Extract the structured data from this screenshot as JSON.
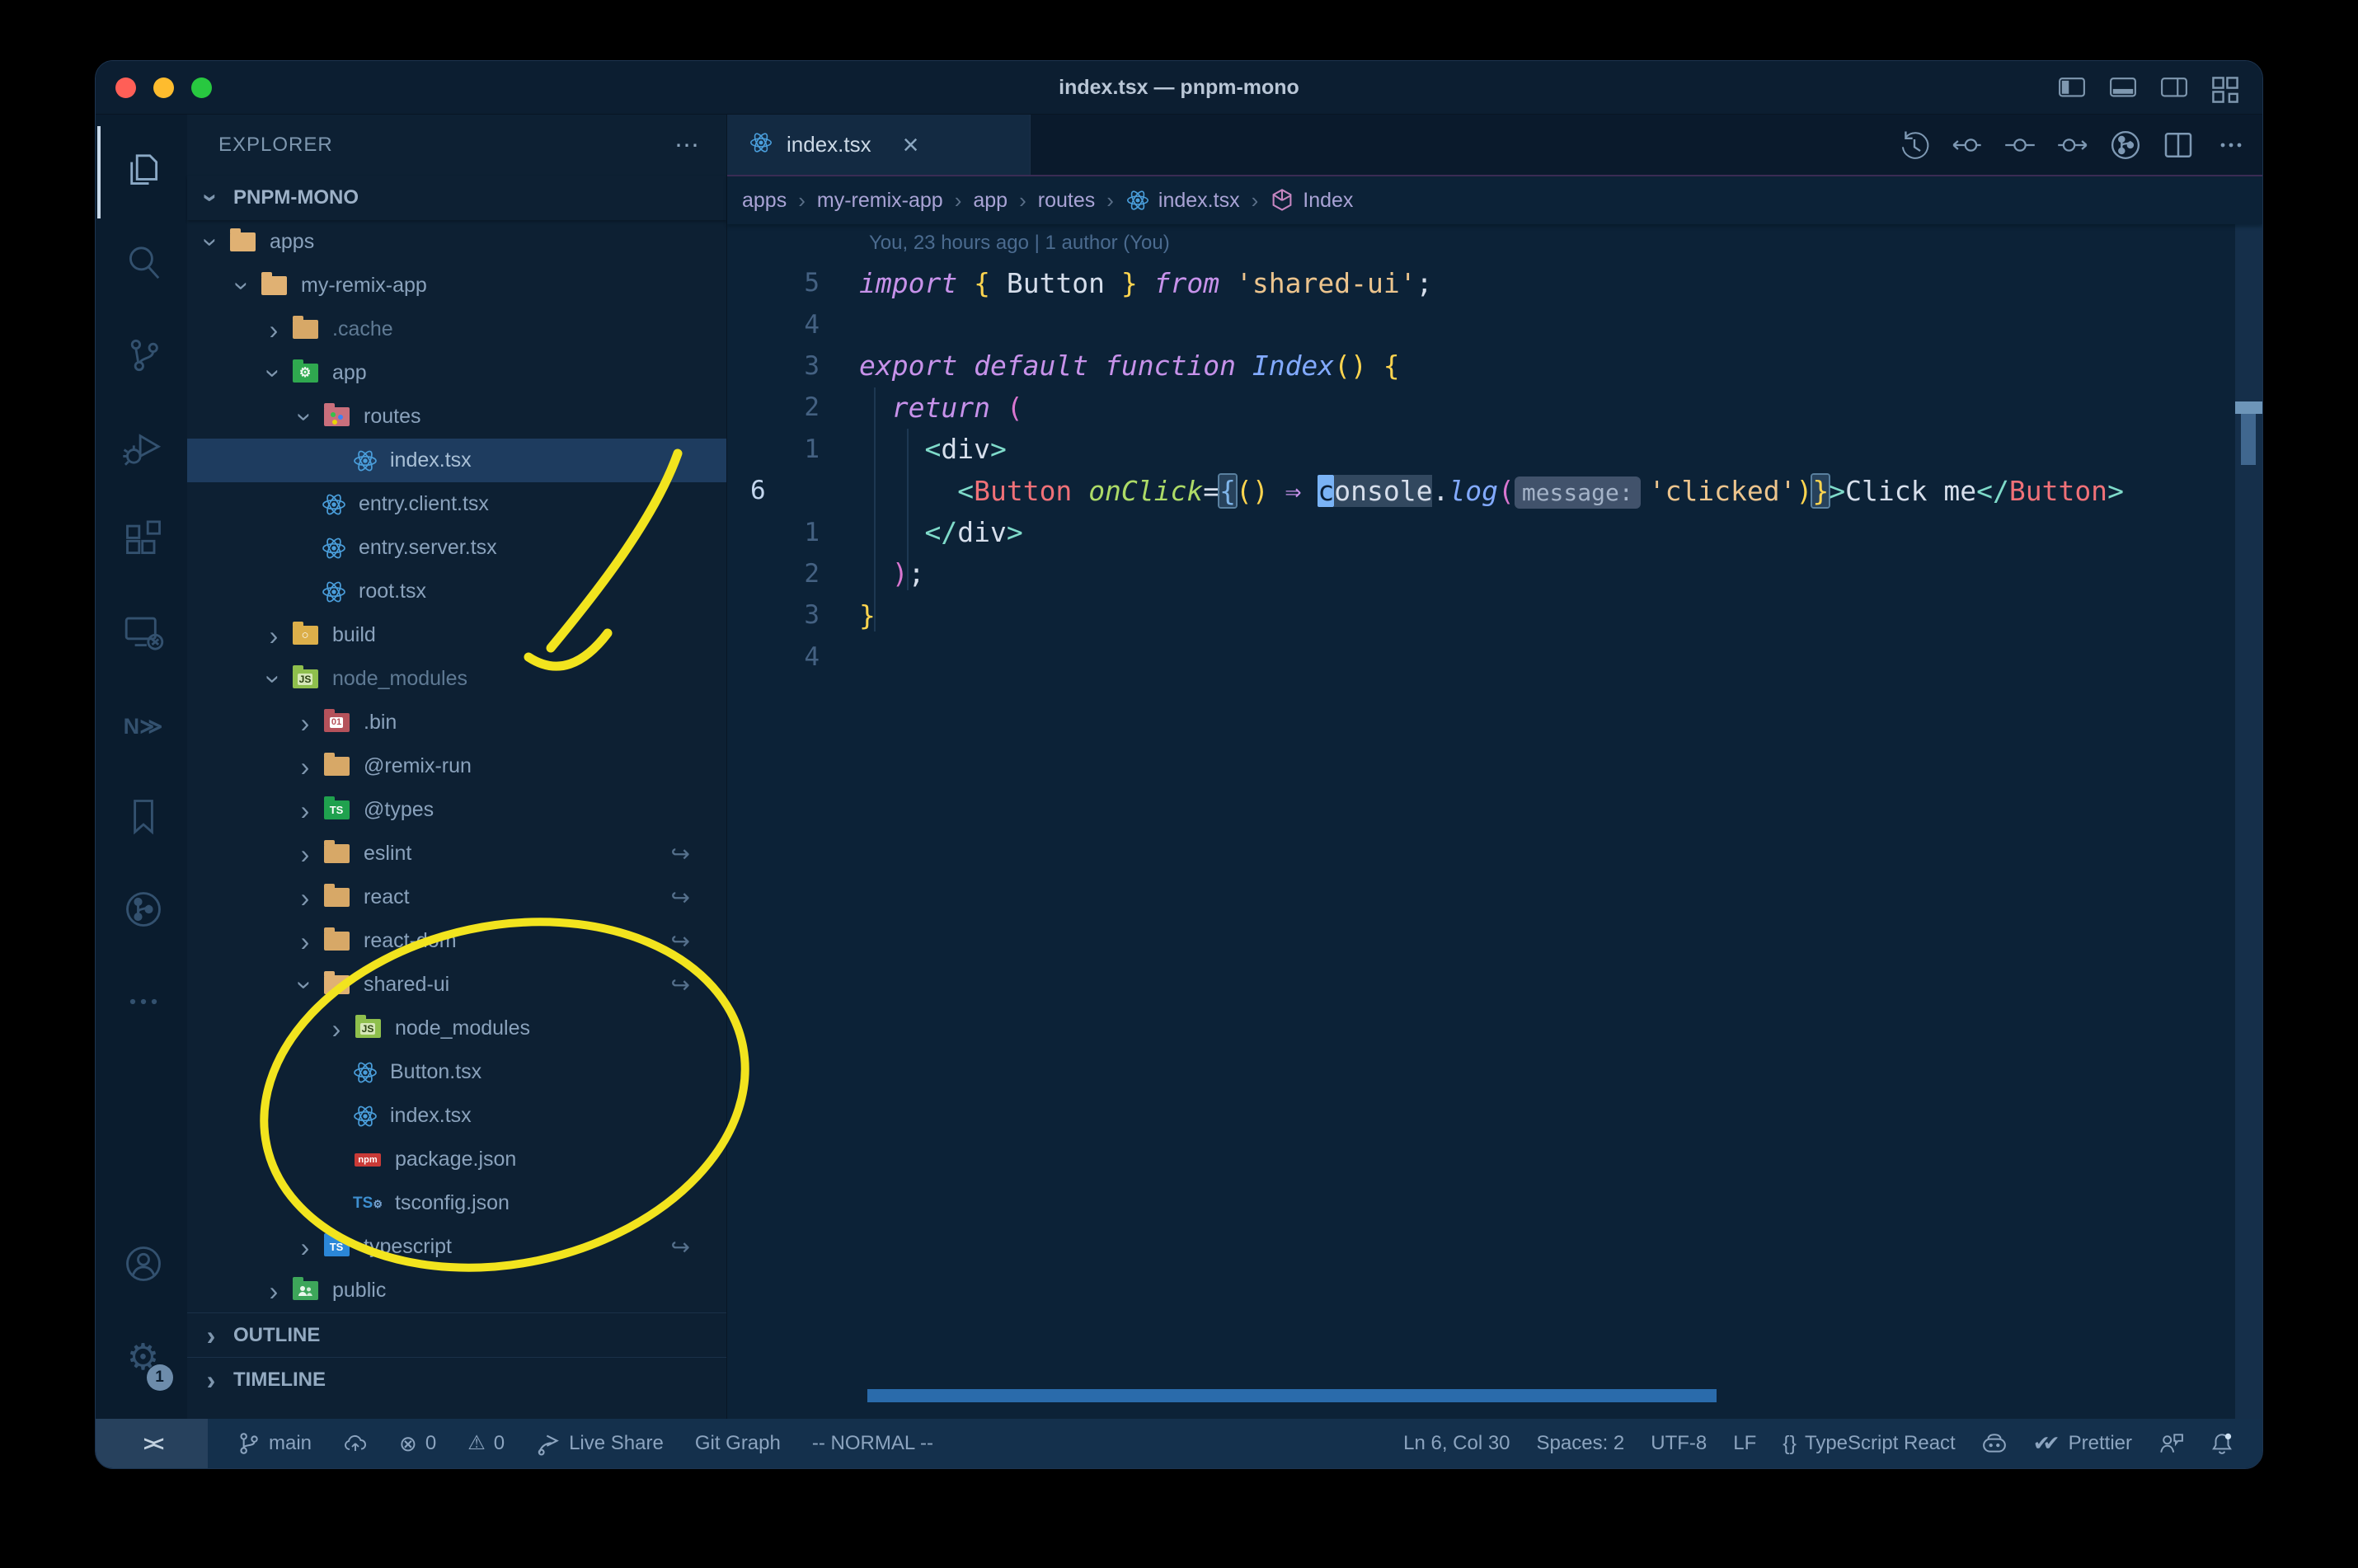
{
  "colors": {
    "annotation_yellow": "#f2e41e",
    "editor_background": "#0c2237",
    "selection_background": "#1e3c5f",
    "react_blue": "#4a9edb"
  },
  "window": {
    "title": "index.tsx — pnpm-mono"
  },
  "titlebar_icons": [
    {
      "name": "layout-sidebar-left-icon"
    },
    {
      "name": "layout-panel-icon"
    },
    {
      "name": "layout-sidebar-right-icon"
    },
    {
      "name": "layout-grid-icon"
    }
  ],
  "activity_bar": {
    "top": [
      {
        "name": "explorer",
        "icon": "files-icon",
        "active": true
      },
      {
        "name": "search",
        "icon": "search-icon"
      },
      {
        "name": "source-control",
        "icon": "source-control-icon"
      },
      {
        "name": "run-debug",
        "icon": "debug-icon"
      },
      {
        "name": "extensions",
        "icon": "extensions-icon"
      },
      {
        "name": "remote-explorer",
        "icon": "remote-explorer-icon"
      },
      {
        "name": "nx-console",
        "icon": "nx-icon"
      },
      {
        "name": "bookmarks",
        "icon": "bookmark-icon"
      },
      {
        "name": "git-graph",
        "icon": "git-graph-circle-icon"
      },
      {
        "name": "more",
        "icon": "ellipsis-icon"
      }
    ],
    "bottom": [
      {
        "name": "accounts",
        "icon": "account-icon"
      },
      {
        "name": "settings",
        "icon": "gear-icon",
        "badge": "1"
      }
    ]
  },
  "sidebar": {
    "header": "EXPLORER",
    "header_more": "⋯",
    "section": "PNPM-MONO",
    "tree": [
      {
        "label": "apps",
        "icon": "folder-open-icon",
        "depth": 1,
        "twist": "open"
      },
      {
        "label": "my-remix-app",
        "icon": "folder-open-icon",
        "depth": 2,
        "twist": "open"
      },
      {
        "label": ".cache",
        "icon": "folder-icon",
        "depth": 3,
        "twist": "closed",
        "dim": true
      },
      {
        "label": "app",
        "icon": "folder-app-icon",
        "depth": 3,
        "twist": "open"
      },
      {
        "label": "routes",
        "icon": "folder-routes-icon",
        "depth": 4,
        "twist": "open"
      },
      {
        "label": "index.tsx",
        "icon": "react-icon",
        "depth": 5,
        "file": true,
        "selected": true
      },
      {
        "label": "entry.client.tsx",
        "icon": "react-icon",
        "depth": 4,
        "file": true
      },
      {
        "label": "entry.server.tsx",
        "icon": "react-icon",
        "depth": 4,
        "file": true
      },
      {
        "label": "root.tsx",
        "icon": "react-icon",
        "depth": 4,
        "file": true
      },
      {
        "label": "build",
        "icon": "folder-dist-icon",
        "depth": 3,
        "twist": "closed"
      },
      {
        "label": "node_modules",
        "icon": "folder-node-icon",
        "depth": 3,
        "twist": "open",
        "dim": true
      },
      {
        "label": ".bin",
        "icon": "folder-bin-icon",
        "depth": 4,
        "twist": "closed"
      },
      {
        "label": "@remix-run",
        "icon": "folder-icon",
        "depth": 4,
        "twist": "closed"
      },
      {
        "label": "@types",
        "icon": "folder-types-icon",
        "depth": 4,
        "twist": "closed"
      },
      {
        "label": "eslint",
        "icon": "folder-icon",
        "depth": 4,
        "twist": "closed",
        "symlink": true
      },
      {
        "label": "react",
        "icon": "folder-icon",
        "depth": 4,
        "twist": "closed",
        "symlink": true
      },
      {
        "label": "react-dom",
        "icon": "folder-icon",
        "depth": 4,
        "twist": "closed",
        "symlink": true
      },
      {
        "label": "shared-ui",
        "icon": "folder-open-icon",
        "depth": 4,
        "twist": "open",
        "symlink": true
      },
      {
        "label": "node_modules",
        "icon": "folder-node-icon",
        "depth": 5,
        "twist": "closed"
      },
      {
        "label": "Button.tsx",
        "icon": "react-icon",
        "depth": 5,
        "file": true
      },
      {
        "label": "index.tsx",
        "icon": "react-icon",
        "depth": 5,
        "file": true
      },
      {
        "label": "package.json",
        "icon": "npm-icon",
        "depth": 5,
        "file": true
      },
      {
        "label": "tsconfig.json",
        "icon": "tsconfig-icon",
        "depth": 5,
        "file": true
      },
      {
        "label": "typescript",
        "icon": "folder-ts-icon",
        "depth": 4,
        "twist": "closed",
        "symlink": true
      },
      {
        "label": "public",
        "icon": "folder-public-icon",
        "depth": 3,
        "twist": "closed"
      }
    ],
    "panels": [
      {
        "label": "OUTLINE"
      },
      {
        "label": "TIMELINE"
      }
    ],
    "symlink_glyph": "↪"
  },
  "editor": {
    "tab": {
      "label": "index.tsx",
      "icon": "react-icon",
      "close_label": "×"
    },
    "actions": [
      {
        "name": "timeline-history",
        "icon": "history-icon"
      },
      {
        "name": "previous-change",
        "icon": "commit-prev-icon"
      },
      {
        "name": "current-commit",
        "icon": "commit-icon"
      },
      {
        "name": "next-change",
        "icon": "commit-next-icon"
      },
      {
        "name": "git-branch-overview",
        "icon": "branch-circle-icon"
      },
      {
        "name": "split-editor",
        "icon": "split-icon"
      },
      {
        "name": "more-actions",
        "icon": "ellipsis-icon"
      }
    ],
    "breadcrumbs": [
      {
        "label": "apps"
      },
      {
        "label": "my-remix-app"
      },
      {
        "label": "app"
      },
      {
        "label": "routes"
      },
      {
        "label": "index.tsx",
        "icon": "react-icon"
      },
      {
        "label": "Index",
        "icon": "symbol-box-icon"
      }
    ],
    "blame": "You, 23 hours ago | 1 author (You)",
    "lines": [
      {
        "rel": "5",
        "tokens": [
          [
            "kw",
            "import"
          ],
          [
            "txt",
            " "
          ],
          [
            "brace",
            "{"
          ],
          [
            "txt",
            " Button "
          ],
          [
            "brace",
            "}"
          ],
          [
            "txt",
            " "
          ],
          [
            "kw",
            "from"
          ],
          [
            "txt",
            " "
          ],
          [
            "str",
            "'shared-ui'"
          ],
          [
            "txt",
            ";"
          ]
        ]
      },
      {
        "rel": "4",
        "tokens": []
      },
      {
        "rel": "3",
        "tokens": [
          [
            "kw",
            "export default function "
          ],
          [
            "fn",
            "Index"
          ],
          [
            "brace",
            "()"
          ],
          [
            "txt",
            " "
          ],
          [
            "brace",
            "{"
          ]
        ]
      },
      {
        "rel": "2",
        "tokens": [
          [
            "txt",
            "  "
          ],
          [
            "kw",
            "return"
          ],
          [
            "txt",
            " "
          ],
          [
            "paren",
            "("
          ]
        ]
      },
      {
        "rel": "1",
        "tokens": [
          [
            "txt",
            "    "
          ],
          [
            "tag",
            "<"
          ],
          [
            "txt",
            "div"
          ],
          [
            "tag",
            ">"
          ]
        ]
      },
      {
        "num": "6",
        "current": true,
        "tokens": [
          [
            "txt",
            "      "
          ],
          [
            "tag",
            "<"
          ],
          [
            "comp",
            "Button"
          ],
          [
            "txt",
            " "
          ],
          [
            "attr",
            "onClick"
          ],
          [
            "txt",
            "="
          ],
          [
            "boxO",
            "{"
          ],
          [
            "brace",
            "()"
          ],
          [
            "txt",
            " "
          ],
          [
            "arrow",
            "⇒"
          ],
          [
            "txt",
            " "
          ],
          [
            "cursor",
            "c"
          ],
          [
            "hl",
            "onsole"
          ],
          [
            "txt",
            "."
          ],
          [
            "fn",
            "log"
          ],
          [
            "paren",
            "("
          ],
          [
            "inlay",
            "message:"
          ],
          [
            "str",
            "'clicked'"
          ],
          [
            "brace",
            ")"
          ],
          [
            "boxC",
            "}"
          ],
          [
            "tag",
            ">"
          ],
          [
            "txt",
            "Click me"
          ],
          [
            "tag",
            "</"
          ],
          [
            "comp",
            "Button"
          ],
          [
            "tag",
            ">"
          ]
        ]
      },
      {
        "rel": "1",
        "tokens": [
          [
            "txt",
            "    "
          ],
          [
            "tag",
            "</"
          ],
          [
            "txt",
            "div"
          ],
          [
            "tag",
            ">"
          ]
        ]
      },
      {
        "rel": "2",
        "tokens": [
          [
            "txt",
            "  "
          ],
          [
            "paren",
            ")"
          ],
          [
            "txt",
            ";"
          ]
        ]
      },
      {
        "rel": "3",
        "tokens": [
          [
            "brace",
            "}"
          ]
        ]
      },
      {
        "rel": "4",
        "tokens": []
      }
    ]
  },
  "status_bar": {
    "left": [
      {
        "name": "remote-indicator",
        "icon": "remote-icon",
        "label": ""
      },
      {
        "name": "git-branch",
        "icon": "git-branch-icon",
        "label": "main"
      },
      {
        "name": "sync-changes",
        "icon": "cloud-upload-icon",
        "label": ""
      },
      {
        "name": "problems-errors",
        "icon": "error-icon",
        "label": "0"
      },
      {
        "name": "problems-warnings",
        "icon": "warning-icon",
        "label": "0"
      },
      {
        "name": "live-share",
        "icon": "live-share-icon",
        "label": "Live Share"
      },
      {
        "name": "git-graph",
        "label": "Git Graph"
      },
      {
        "name": "vim-mode",
        "label": "-- NORMAL --"
      }
    ],
    "right": [
      {
        "name": "cursor-position",
        "label": "Ln 6, Col 30"
      },
      {
        "name": "indentation",
        "label": "Spaces: 2"
      },
      {
        "name": "encoding",
        "label": "UTF-8"
      },
      {
        "name": "eol-sequence",
        "label": "LF"
      },
      {
        "name": "language-mode",
        "icon": "brackets-icon",
        "label": "TypeScript React"
      },
      {
        "name": "copilot",
        "icon": "copilot-icon",
        "label": ""
      },
      {
        "name": "formatter",
        "icon": "double-check-icon",
        "label": "Prettier"
      },
      {
        "name": "feedback",
        "icon": "feedback-icon",
        "label": ""
      },
      {
        "name": "notifications",
        "icon": "bell-icon",
        "label": ""
      }
    ]
  }
}
